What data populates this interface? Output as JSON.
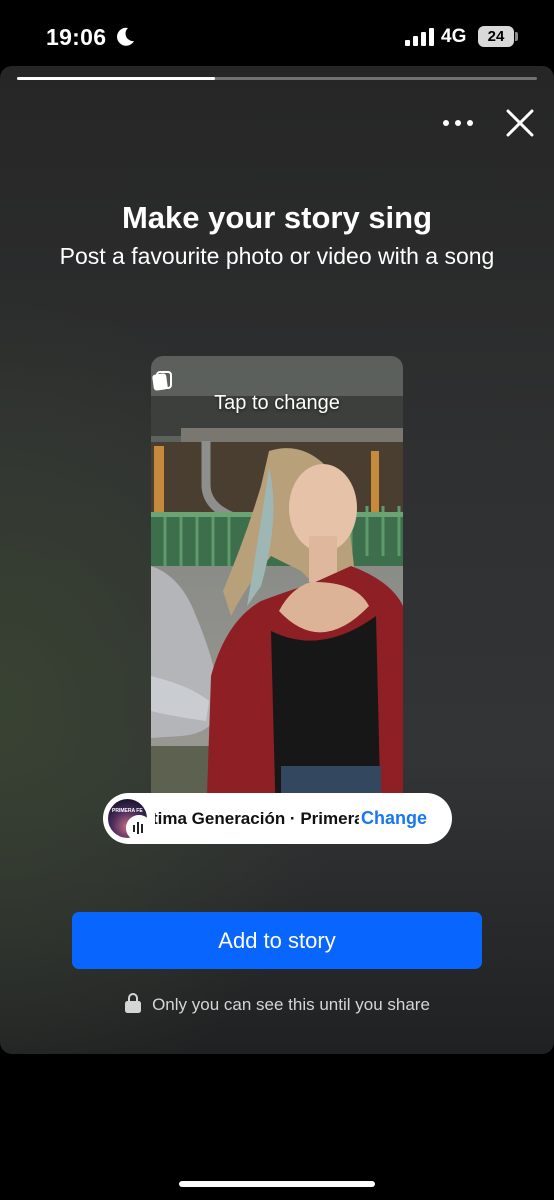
{
  "status_bar": {
    "time": "19:06",
    "network": "4G",
    "battery": "24"
  },
  "story": {
    "progress_fraction": 0.38,
    "more_icon": "more-horizontal-icon",
    "close_icon": "close-icon"
  },
  "header": {
    "title": "Make your story sing",
    "subtitle": "Post a favourite photo or video with a song"
  },
  "photo": {
    "tap_to_change": "Tap to change"
  },
  "music": {
    "album_label": "PRIMERA FE",
    "song_text": "Última Generación · Primera Fe",
    "change_label": "Change"
  },
  "actions": {
    "add_to_story": "Add to story",
    "privacy_note": "Only you can see this until you share"
  },
  "colors": {
    "primary_button": "#0866ff",
    "link": "#1877f2"
  }
}
